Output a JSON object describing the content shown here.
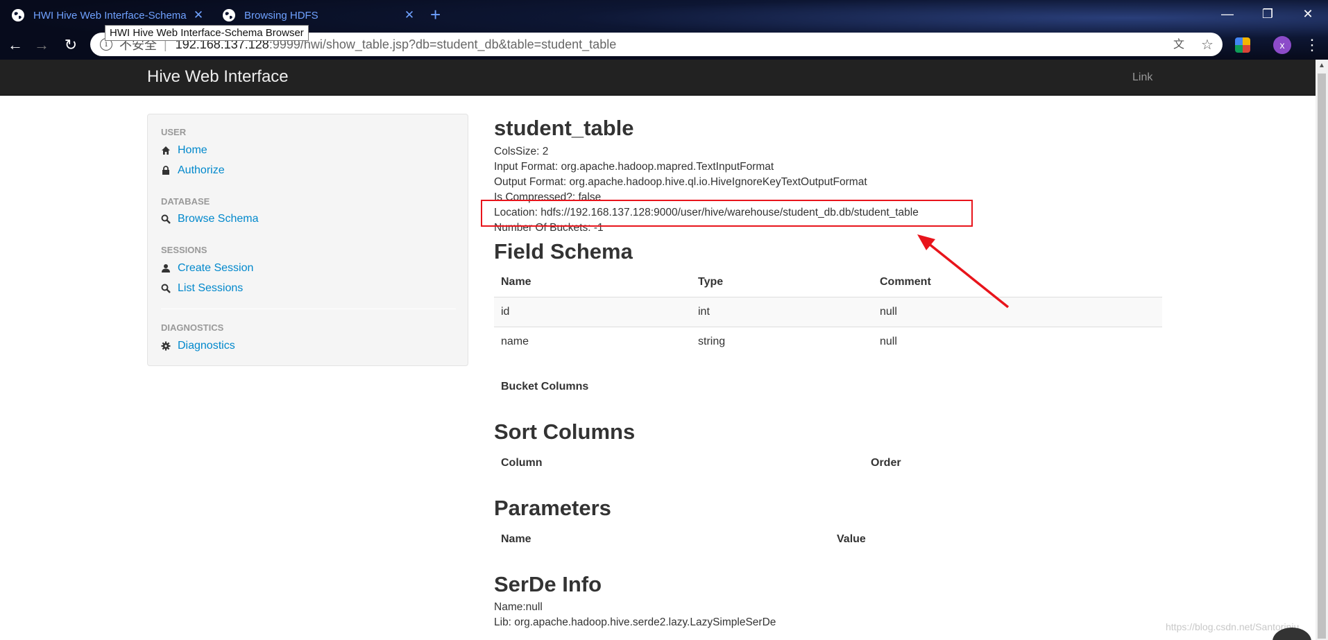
{
  "browser": {
    "tabs": [
      {
        "title": "HWI Hive Web Interface-Schema Browser",
        "active": true
      },
      {
        "title": "Browsing HDFS",
        "active": false
      }
    ],
    "tooltip": "HWI Hive Web Interface-Schema Browser",
    "address": {
      "security_label": "不安全",
      "separator": "|",
      "host": "192.168.137.128",
      "rest": ":9999/hwi/show_table.jsp?db=student_db&table=student_table"
    },
    "profile_initial": "x"
  },
  "navbar": {
    "brand": "Hive Web Interface",
    "link": "Link"
  },
  "sidebar": {
    "sections": [
      {
        "header": "USER",
        "items": [
          {
            "label": "Home",
            "icon": "home-icon"
          },
          {
            "label": "Authorize",
            "icon": "lock-icon"
          }
        ]
      },
      {
        "header": "DATABASE",
        "items": [
          {
            "label": "Browse Schema",
            "icon": "search-icon"
          }
        ]
      },
      {
        "header": "SESSIONS",
        "items": [
          {
            "label": "Create Session",
            "icon": "user-icon"
          },
          {
            "label": "List Sessions",
            "icon": "search-icon"
          }
        ]
      },
      {
        "header": "DIAGNOSTICS",
        "items": [
          {
            "label": "Diagnostics",
            "icon": "gear-icon"
          }
        ]
      }
    ]
  },
  "main": {
    "title": "student_table",
    "properties": [
      "ColsSize: 2",
      "Input Format: org.apache.hadoop.mapred.TextInputFormat",
      "Output Format: org.apache.hadoop.hive.ql.io.HiveIgnoreKeyTextOutputFormat",
      "Is Compressed?: false",
      "Location: hdfs://192.168.137.128:9000/user/hive/warehouse/student_db.db/student_table",
      "Number Of Buckets: -1"
    ],
    "field_schema": {
      "heading": "Field Schema",
      "columns": [
        "Name",
        "Type",
        "Comment"
      ],
      "rows": [
        [
          "id",
          "int",
          "null"
        ],
        [
          "name",
          "string",
          "null"
        ]
      ]
    },
    "bucket_columns": {
      "heading": "Bucket Columns"
    },
    "sort_columns": {
      "heading": "Sort Columns",
      "columns": [
        "Column",
        "Order"
      ]
    },
    "parameters": {
      "heading": "Parameters",
      "columns": [
        "Name",
        "Value"
      ]
    },
    "serde_info": {
      "heading": "SerDe Info",
      "lines": [
        "Name:null",
        "Lib: org.apache.hadoop.hive.serde2.lazy.LazySimpleSerDe"
      ]
    }
  },
  "watermark": "https://blog.csdn.net/Santoriniu",
  "colors": {
    "link": "#0088cc",
    "navbar": "#222222",
    "annotation": "#e8141b",
    "tab_text": "#6fa1ff"
  }
}
